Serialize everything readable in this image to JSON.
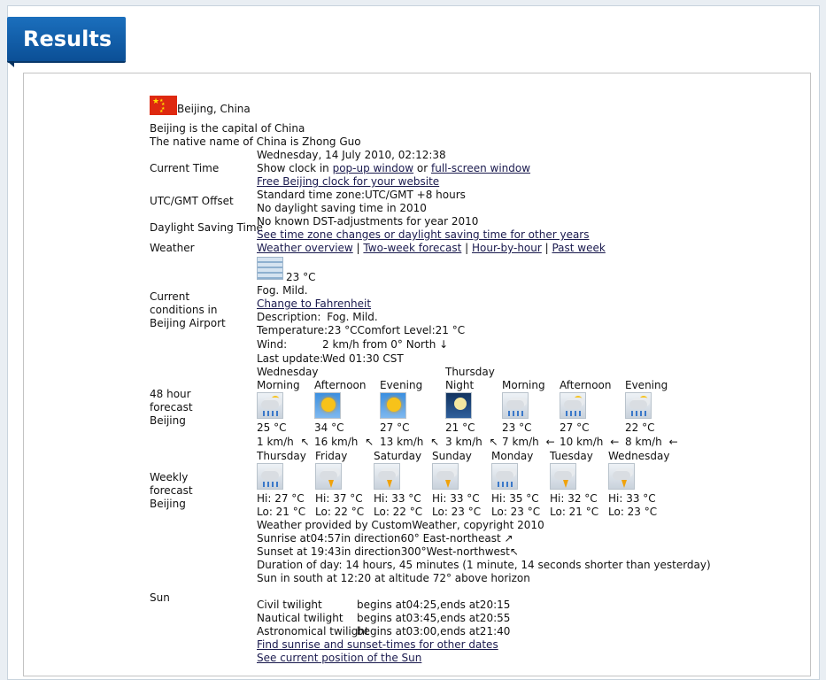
{
  "header": {
    "title": "Results"
  },
  "location": {
    "city": "Beijing, China",
    "capital_note": "Beijing is the capital of China",
    "native_note": "The native name of China is Zhong Guo"
  },
  "current_time": {
    "label": "Current Time",
    "value": "Wednesday, 14 July 2010, 02:12:38",
    "show_clock_prefix": "Show clock in ",
    "popup_link": "pop-up window",
    "or_text": " or ",
    "fullscreen_link": "full-screen window",
    "free_clock_link": "Free Beijing clock for your website"
  },
  "utc": {
    "label": "UTC/GMT Offset",
    "standard": "Standard time zone:UTC/GMT +8 hours",
    "dst_note": "No daylight saving time in 2010"
  },
  "dst": {
    "label": "Daylight Saving Time",
    "note": "No known DST-adjustments for year 2010",
    "link": "See time zone changes or daylight saving time for other years"
  },
  "weather": {
    "label": "Weather",
    "links": [
      "Weather overview",
      "Two-week forecast",
      "Hour-by-hour",
      "Past week"
    ],
    "sep": " | "
  },
  "current_conditions": {
    "label_line1": "Current",
    "label_line2": "conditions in",
    "label_line3": "Beijing Airport",
    "temp": "23 °C",
    "summary": "Fog. Mild.",
    "change_link": "Change to Fahrenheit",
    "desc_label": "Description:",
    "desc_value": "Fog. Mild.",
    "temp_label": "Temperature:",
    "temp_value": "23 °CComfort Level:21 °C",
    "wind_label": "Wind:",
    "wind_value": "2 km/h from 0° North",
    "wind_arrow": "↓",
    "update_label": "Last update:",
    "update_value": "Wed 01:30 CST"
  },
  "forecast48": {
    "label_line1": "48 hour",
    "label_line2": "forecast",
    "label_line3": "Beijing",
    "day1": "Wednesday",
    "day2": "Thursday",
    "periods": [
      {
        "name": "Morning",
        "icon": "rain-sun-icon",
        "temp": "25 °C",
        "wind": "1 km/h",
        "arrow": "↖"
      },
      {
        "name": "Afternoon",
        "icon": "sunny-icon",
        "temp": "34 °C",
        "wind": "16 km/h",
        "arrow": "↖"
      },
      {
        "name": "Evening",
        "icon": "sunny-icon",
        "temp": "27 °C",
        "wind": "13 km/h",
        "arrow": "↖"
      },
      {
        "name": "Night",
        "icon": "moon-icon",
        "temp": "21 °C",
        "wind": "3 km/h",
        "arrow": "↖"
      },
      {
        "name": "Morning",
        "icon": "rain-icon",
        "temp": "23 °C",
        "wind": "7 km/h",
        "arrow": "←"
      },
      {
        "name": "Afternoon",
        "icon": "rain-sun-icon",
        "temp": "27 °C",
        "wind": "10 km/h",
        "arrow": "←"
      },
      {
        "name": "Evening",
        "icon": "rain-sun-icon",
        "temp": "22 °C",
        "wind": "8 km/h",
        "arrow": "←"
      }
    ]
  },
  "weekly": {
    "label_line1": "Weekly",
    "label_line2": "forecast",
    "label_line3": "Beijing",
    "days": [
      {
        "name": "Thursday",
        "icon": "rain-icon",
        "hi": "Hi: 27 °C",
        "lo": "Lo: 21 °C"
      },
      {
        "name": "Friday",
        "icon": "thunder-icon",
        "hi": "Hi: 37 °C",
        "lo": "Lo: 22 °C"
      },
      {
        "name": "Saturday",
        "icon": "thunder-icon",
        "hi": "Hi: 33 °C",
        "lo": "Lo: 22 °C"
      },
      {
        "name": "Sunday",
        "icon": "thunder-icon",
        "hi": "Hi: 33 °C",
        "lo": "Lo: 23 °C"
      },
      {
        "name": "Monday",
        "icon": "rain-icon",
        "hi": "Hi: 35 °C",
        "lo": "Lo: 23 °C"
      },
      {
        "name": "Tuesday",
        "icon": "thunder-icon",
        "hi": "Hi: 32 °C",
        "lo": "Lo: 21 °C"
      },
      {
        "name": "Wednesday",
        "icon": "thunder-icon",
        "hi": "Hi: 33 °C",
        "lo": "Lo: 23 °C"
      }
    ],
    "provider": "Weather provided by CustomWeather, copyright 2010"
  },
  "sun": {
    "label": "Sun",
    "sunrise": "Sunrise at04:57in direction60°  East-northeast",
    "sunrise_arrow": "↗",
    "sunset": "Sunset at 19:43in direction300°West-northwest",
    "sunset_arrow": "↖",
    "duration": "Duration of day: 14 hours, 45 minutes (1 minute, 14 seconds shorter than yesterday)",
    "south": "Sun in south at 12:20 at altitude 72° above horizon",
    "civil_label": "Civil twilight",
    "civil_value": "begins at04:25,ends at20:15",
    "nautical_label": "Nautical twilight",
    "nautical_value": "begins at03:45,ends at20:55",
    "astro_label": "Astronomical twilight",
    "astro_value": "begins at03:00,ends at21:40",
    "find_link": "Find sunrise and sunset-times for other dates",
    "position_link": "See current position of the Sun"
  },
  "colors": {
    "tab": "#0b4f96",
    "link": "#1a1a4e",
    "flag": "#de2910"
  }
}
